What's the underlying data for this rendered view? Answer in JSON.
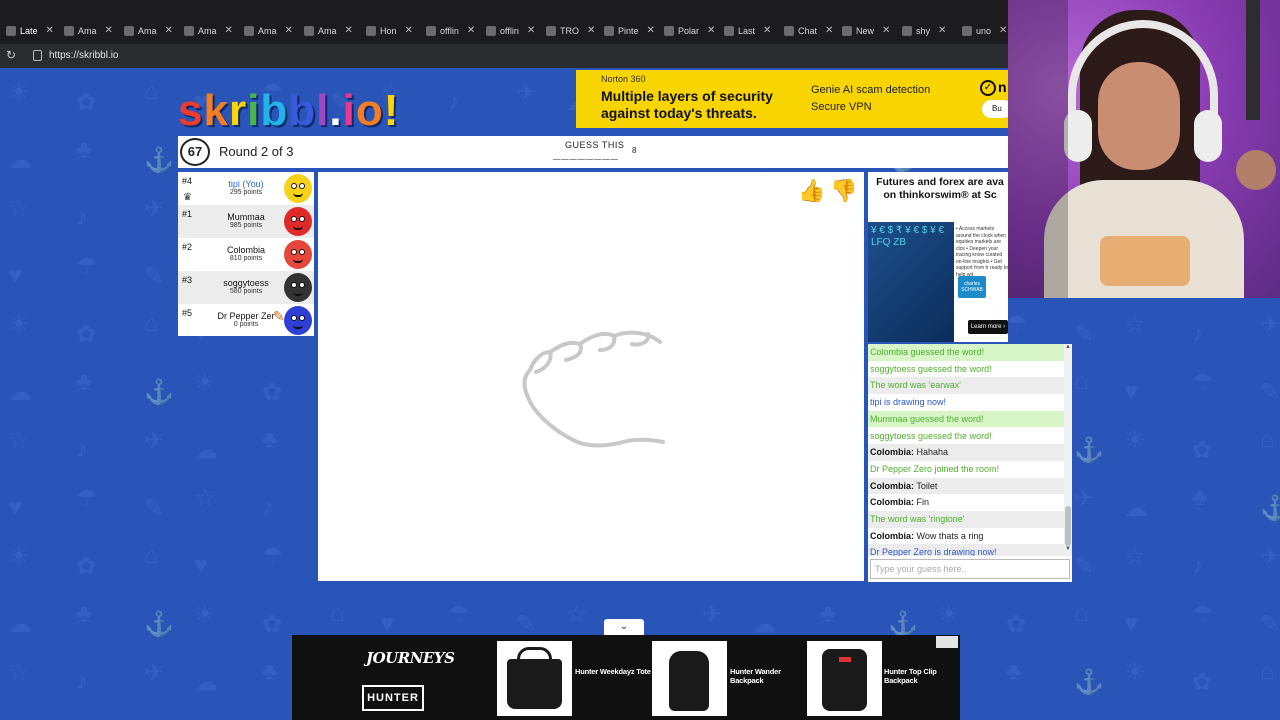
{
  "browser": {
    "tabs": [
      {
        "label": "Late"
      },
      {
        "label": "Ama"
      },
      {
        "label": "Ama"
      },
      {
        "label": "Ama"
      },
      {
        "label": "Ama"
      },
      {
        "label": "Ama"
      },
      {
        "label": "Hon"
      },
      {
        "label": "offlin"
      },
      {
        "label": "offlin"
      },
      {
        "label": "TRO"
      },
      {
        "label": "Pinte"
      },
      {
        "label": "Polar"
      },
      {
        "label": "Last"
      },
      {
        "label": "Chat"
      },
      {
        "label": "New"
      },
      {
        "label": "shy"
      },
      {
        "label": "uno"
      }
    ],
    "url": "https://skribbl.io"
  },
  "logo": {
    "text": [
      "s",
      "k",
      "r",
      "i",
      "b",
      "b",
      "l",
      ".",
      "i",
      "o",
      "!"
    ],
    "colors": [
      "#ef3b2c",
      "#f57f20",
      "#ffd400",
      "#49b648",
      "#22b3e8",
      "#3a5bd9",
      "#a246c4",
      "#ffffff",
      "#e9388f",
      "#f57f20",
      "#ffd400"
    ]
  },
  "norton_ad": {
    "brand": "Norton 360",
    "headline": "Multiple layers of security against today's threats.",
    "bullets": [
      "Genie AI scam detection",
      "Secure VPN"
    ],
    "buy": "Bu",
    "n": "n"
  },
  "game": {
    "timer": "67",
    "round": "Round 2 of 3",
    "guess_label": "GUESS THIS",
    "blanks": "________",
    "letter_count": "8"
  },
  "players": [
    {
      "rank": "#4",
      "name": "tipi (You)",
      "points": "295 points",
      "color": "#f7d21b"
    },
    {
      "rank": "#1",
      "name": "Mummaa",
      "points": "985 points",
      "color": "#e02a2a"
    },
    {
      "rank": "#2",
      "name": "Colombia",
      "points": "810 points",
      "color": "#e6463c"
    },
    {
      "rank": "#3",
      "name": "soggytoess",
      "points": "580 points",
      "color": "#333333"
    },
    {
      "rank": "#5",
      "name": "Dr Pepper Zer",
      "points": "0 points",
      "color": "#2d3fd4"
    }
  ],
  "side_ad": {
    "title": "Futures and forex are ava on thinkorswim® at Sc",
    "bullets": "• Access markets around the clock when equities markets are clos • Deepen your tracing know curated on-line insights • Get support from tr ready to help wit",
    "logo": "charles SCHWAB",
    "learn": "Learn more ›",
    "art_text": "¥ € $ ₹ ¥ € $ ¥ € LFQ ZB"
  },
  "chat": {
    "messages": [
      {
        "text": "Colombia guessed the word!",
        "style": "greenbg"
      },
      {
        "text": "soggytoess guessed the word!",
        "style": "green"
      },
      {
        "text": "The word was 'earwax'",
        "style": "green alt"
      },
      {
        "text": "tipi is drawing now!",
        "style": "blue"
      },
      {
        "text": "Mummaa guessed the word!",
        "style": "greenbg"
      },
      {
        "text": "soggytoess guessed the word!",
        "style": "green"
      },
      {
        "name": "Colombia:",
        "text": "Hahaha",
        "style": "alt"
      },
      {
        "text": "Dr Pepper Zero joined the room!",
        "style": "green"
      },
      {
        "name": "Colombia:",
        "text": "Toilet",
        "style": "alt"
      },
      {
        "name": "Colombia:",
        "text": "Fin",
        "style": ""
      },
      {
        "text": "The word was 'ringtone'",
        "style": "green alt"
      },
      {
        "name": "Colombia:",
        "text": "Wow thats a ring",
        "style": ""
      },
      {
        "text": "Dr Pepper Zero is drawing now!",
        "style": "blue alt"
      }
    ],
    "placeholder": "Type your guess here.."
  },
  "bottom_ad": {
    "brand1": "JOURNEYS",
    "brand2": "HUNTER",
    "products": [
      {
        "label": "Hunter Weekdayz Tote"
      },
      {
        "label": "Hunter Wander Backpack"
      },
      {
        "label": "Hunter Top Clip Backpack"
      }
    ],
    "collapse": "⌄"
  }
}
